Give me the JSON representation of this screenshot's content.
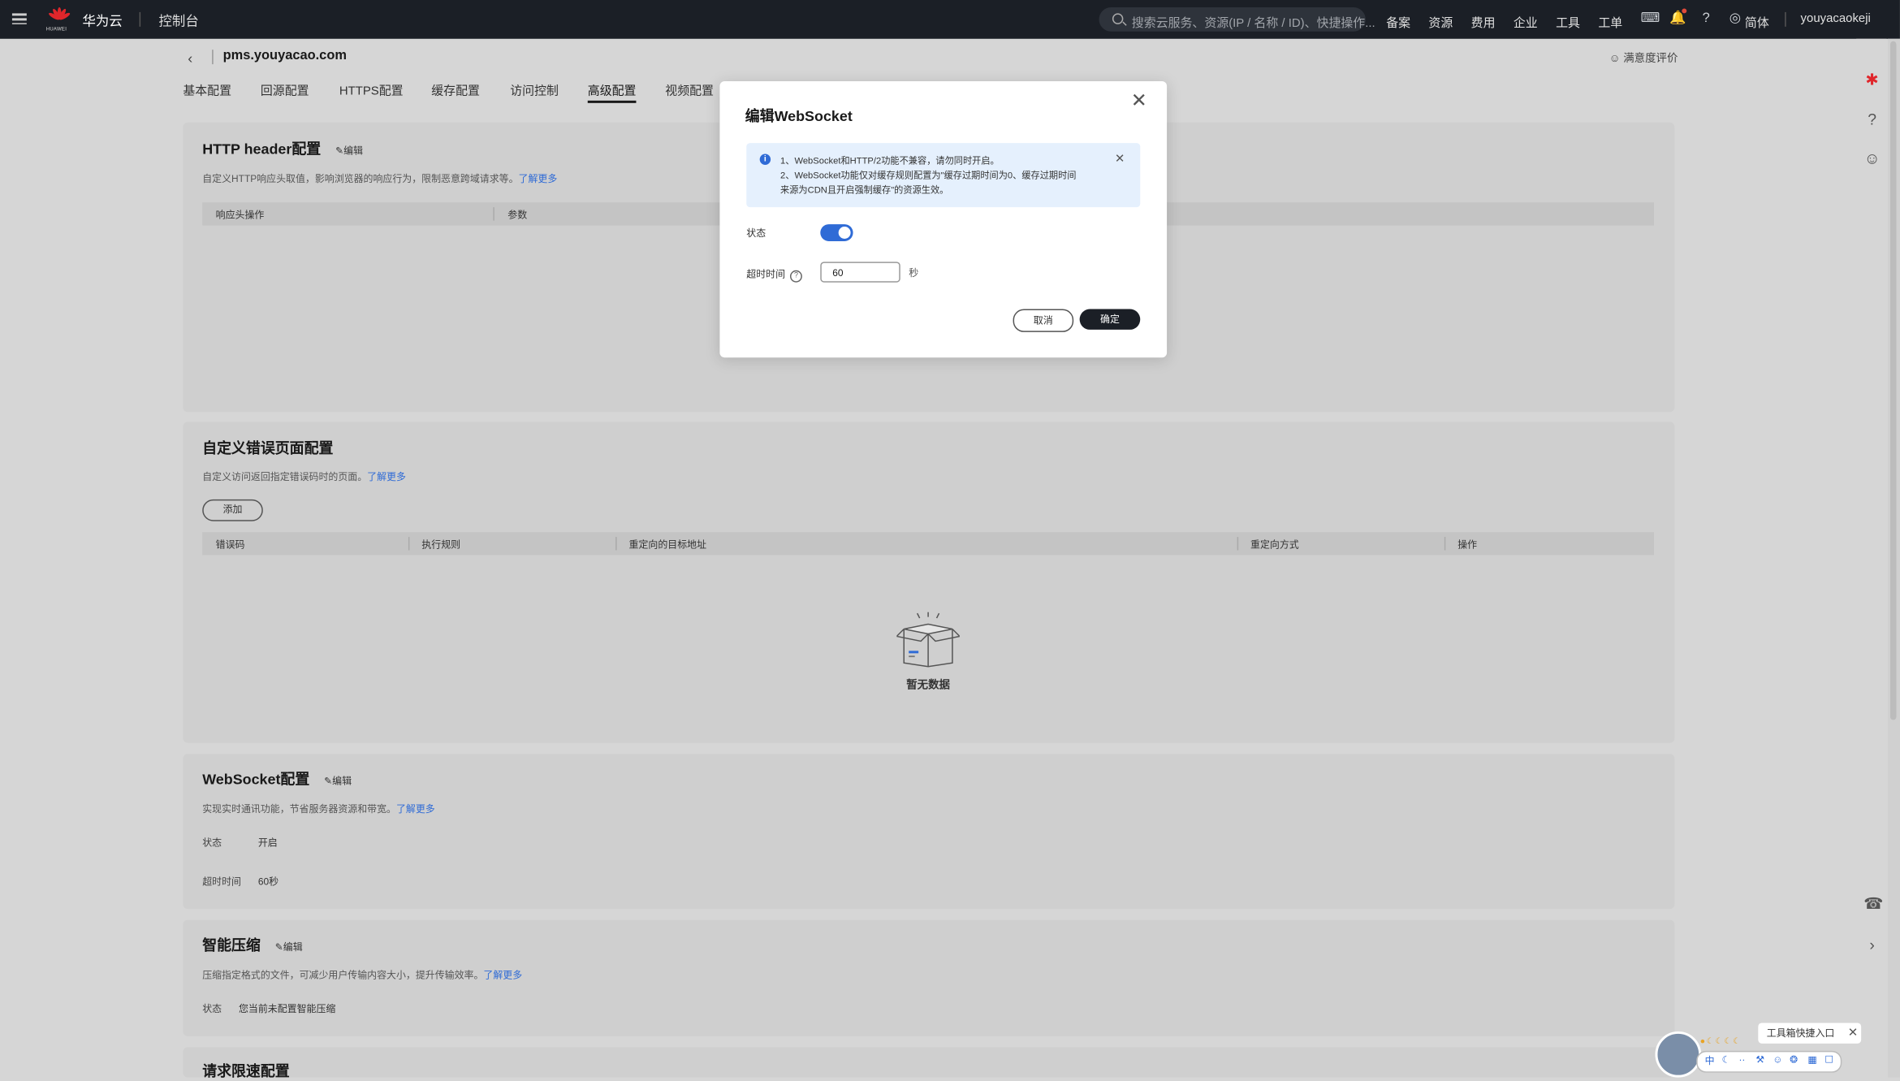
{
  "topbar": {
    "brand": "华为云",
    "logo_text": "HUAWEI",
    "console": "控制台",
    "search_placeholder": "搜索云服务、资源(IP / 名称 / ID)、快捷操作...",
    "nav": [
      "备案",
      "资源",
      "费用",
      "企业",
      "工具",
      "工单"
    ],
    "language": "简体",
    "user": "youyacaokeji"
  },
  "header": {
    "domain": "pms.youyacao.com",
    "rating": "满意度评价"
  },
  "tabs": [
    "基本配置",
    "回源配置",
    "HTTPS配置",
    "缓存配置",
    "访问控制",
    "高级配置",
    "视频配置"
  ],
  "active_tab": "高级配置",
  "http_header": {
    "title": "HTTP header配置",
    "edit": "编辑",
    "desc": "自定义HTTP响应头取值，影响浏览器的响应行为，限制恶意跨域请求等。",
    "learn_more": "了解更多",
    "columns": [
      "响应头操作",
      "参数"
    ]
  },
  "error_page": {
    "title": "自定义错误页面配置",
    "desc": "自定义访问返回指定错误码时的页面。",
    "learn_more": "了解更多",
    "add": "添加",
    "columns": [
      "错误码",
      "执行规则",
      "重定向的目标地址",
      "重定向方式",
      "操作"
    ],
    "empty": "暂无数据"
  },
  "websocket": {
    "title": "WebSocket配置",
    "edit": "编辑",
    "desc": "实现实时通讯功能，节省服务器资源和带宽。",
    "learn_more": "了解更多",
    "status_label": "状态",
    "status_value": "开启",
    "timeout_label": "超时时间",
    "timeout_value": "60秒"
  },
  "compression": {
    "title": "智能压缩",
    "edit": "编辑",
    "desc": "压缩指定格式的文件，可减少用户传输内容大小，提升传输效率。",
    "learn_more": "了解更多",
    "status_label": "状态",
    "status_value": "您当前未配置智能压缩"
  },
  "rate_limit": {
    "title": "请求限速配置"
  },
  "modal": {
    "title": "编辑WebSocket",
    "alert_line1": "1、WebSocket和HTTP/2功能不兼容，请勿同时开启。",
    "alert_line2": "2、WebSocket功能仅对缓存规则配置为\"缓存过期时间为0、缓存过期时间",
    "alert_line3": "来源为CDN且开启强制缓存\"的资源生效。",
    "status_label": "状态",
    "status_on": true,
    "timeout_label": "超时时间",
    "timeout_value": "60",
    "unit": "秒",
    "cancel": "取消",
    "ok": "确定"
  },
  "toolbox": {
    "tip": "工具箱快捷入口"
  },
  "colors": {
    "accent": "#2f6bd6",
    "topbar": "#1b1f26",
    "primary_button": "#1b1f26"
  }
}
